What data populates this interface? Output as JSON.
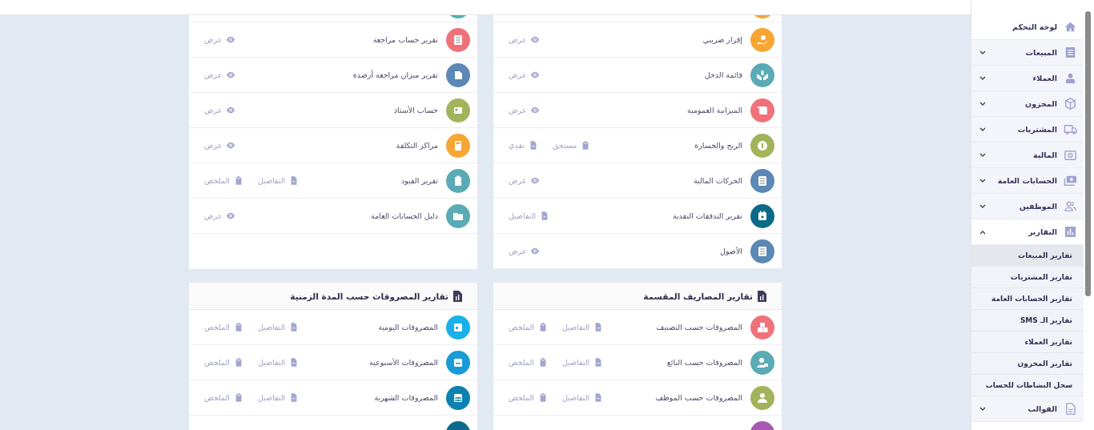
{
  "sidebar": {
    "items": [
      {
        "label": "لوحة التحكم",
        "kind": "link"
      },
      {
        "label": "المبيعات",
        "kind": "group",
        "expanded": false
      },
      {
        "label": "العملاء",
        "kind": "group",
        "expanded": false
      },
      {
        "label": "المخزون",
        "kind": "group",
        "expanded": false
      },
      {
        "label": "المشتريات",
        "kind": "group",
        "expanded": false
      },
      {
        "label": "المالية",
        "kind": "group",
        "expanded": false
      },
      {
        "label": "الحسابات العامة",
        "kind": "group",
        "expanded": false
      },
      {
        "label": "الموظفين",
        "kind": "group",
        "expanded": false
      },
      {
        "label": "التقارير",
        "kind": "group",
        "expanded": true,
        "children": [
          {
            "label": "تقارير المبيعات",
            "selected": true
          },
          {
            "label": "تقارير المشتريات",
            "selected": false
          },
          {
            "label": "تقارير الحسابات العامة",
            "selected": false
          },
          {
            "label": "تقارير الـ SMS",
            "selected": false
          },
          {
            "label": "تقارير العملاء",
            "selected": false
          },
          {
            "label": "تقارير المخزون",
            "selected": false
          },
          {
            "label": "سجل النشاطات للحساب",
            "selected": false
          }
        ]
      },
      {
        "label": "القوالب",
        "kind": "group",
        "expanded": false
      }
    ]
  },
  "cards": [
    {
      "items": [
        {
          "kind": "partial",
          "color": "#f7a535"
        },
        {
          "kind": "row",
          "label": "إقرار ضريبي",
          "color": "#f7a535",
          "actions": [
            {
              "label": "عرض",
              "kind": "eye"
            }
          ]
        },
        {
          "kind": "row",
          "label": "قائمة الدخل",
          "color": "#5aabb5",
          "actions": [
            {
              "label": "عرض",
              "kind": "eye"
            }
          ]
        },
        {
          "kind": "row",
          "label": "الميزانية العمومية",
          "color": "#ef727a",
          "actions": [
            {
              "label": "عرض",
              "kind": "eye"
            }
          ]
        },
        {
          "kind": "row",
          "label": "الربح والخسارة",
          "color": "#a1b45b",
          "actions": [
            {
              "label": "مستحق",
              "kind": "clipboard"
            },
            {
              "label": "نقدي",
              "kind": "file"
            }
          ]
        },
        {
          "kind": "row",
          "label": "الحركات المالية",
          "color": "#5b88b5",
          "actions": [
            {
              "label": "عرض",
              "kind": "eye"
            }
          ]
        },
        {
          "kind": "row",
          "label": "تقرير التدفقات النقدية",
          "color": "#0b6a8a",
          "actions": [
            {
              "label": "التفاصيل",
              "kind": "file"
            }
          ]
        },
        {
          "kind": "row",
          "label": "الأصول",
          "color": "#5b88b5",
          "actions": [
            {
              "label": "عرض",
              "kind": "eye"
            }
          ]
        }
      ]
    },
    {
      "items": [
        {
          "kind": "partial",
          "color": "#5aabb5"
        },
        {
          "kind": "row",
          "label": "تقرير حساب مراجعة",
          "color": "#ef727a",
          "actions": [
            {
              "label": "عرض",
              "kind": "eye"
            }
          ]
        },
        {
          "kind": "row",
          "label": "تقرير ميزان مراجعة أرصدة",
          "color": "#5b88b5",
          "actions": [
            {
              "label": "عرض",
              "kind": "eye"
            }
          ]
        },
        {
          "kind": "row",
          "label": "حساب الأستاذ",
          "color": "#a1b45b",
          "actions": [
            {
              "label": "عرض",
              "kind": "eye"
            }
          ]
        },
        {
          "kind": "row",
          "label": "مراكز التكلفة",
          "color": "#f7a535",
          "actions": [
            {
              "label": "عرض",
              "kind": "eye"
            }
          ]
        },
        {
          "kind": "row",
          "label": "تقرير القيود",
          "color": "#5aabb5",
          "actions": [
            {
              "label": "التفاصيل",
              "kind": "file"
            },
            {
              "label": "الملخص",
              "kind": "clipboard"
            }
          ]
        },
        {
          "kind": "row",
          "label": "دليل الحسابات العامة",
          "color": "#5aabb5",
          "actions": [
            {
              "label": "عرض",
              "kind": "eye"
            }
          ]
        }
      ]
    },
    {
      "title": "تقارير المصاريف المقسمة",
      "items": [
        {
          "kind": "row",
          "label": "المصروفات حسب التصنيف",
          "color": "#ef727a",
          "actions": [
            {
              "label": "التفاصيل",
              "kind": "file"
            },
            {
              "label": "الملخص",
              "kind": "clipboard"
            }
          ]
        },
        {
          "kind": "row",
          "label": "المصروفات حسب البائع",
          "color": "#5aabb5",
          "actions": [
            {
              "label": "التفاصيل",
              "kind": "file"
            },
            {
              "label": "الملخص",
              "kind": "clipboard"
            }
          ]
        },
        {
          "kind": "row",
          "label": "المصروفات حسب الموظف",
          "color": "#a1b45b",
          "actions": [
            {
              "label": "التفاصيل",
              "kind": "file"
            },
            {
              "label": "الملخص",
              "kind": "clipboard"
            }
          ]
        },
        {
          "kind": "partial-bottom",
          "color": "#a45ab0"
        }
      ]
    },
    {
      "title": "تقارير المصروفات حسب المدة الزمنية",
      "items": [
        {
          "kind": "row",
          "label": "المصروفات اليومية",
          "color": "#1ab0ea",
          "actions": [
            {
              "label": "التفاصيل",
              "kind": "file"
            },
            {
              "label": "الملخص",
              "kind": "clipboard"
            }
          ]
        },
        {
          "kind": "row",
          "label": "المصروفات الأسبوعية",
          "color": "#1a9bd6",
          "actions": [
            {
              "label": "التفاصيل",
              "kind": "file"
            },
            {
              "label": "الملخص",
              "kind": "clipboard"
            }
          ]
        },
        {
          "kind": "row",
          "label": "المصروفات الشهرية",
          "color": "#0b82b0",
          "actions": [
            {
              "label": "التفاصيل",
              "kind": "file"
            },
            {
              "label": "الملخص",
              "kind": "clipboard"
            }
          ]
        },
        {
          "kind": "partial-bottom",
          "color": "#0b6a8a"
        }
      ]
    }
  ]
}
